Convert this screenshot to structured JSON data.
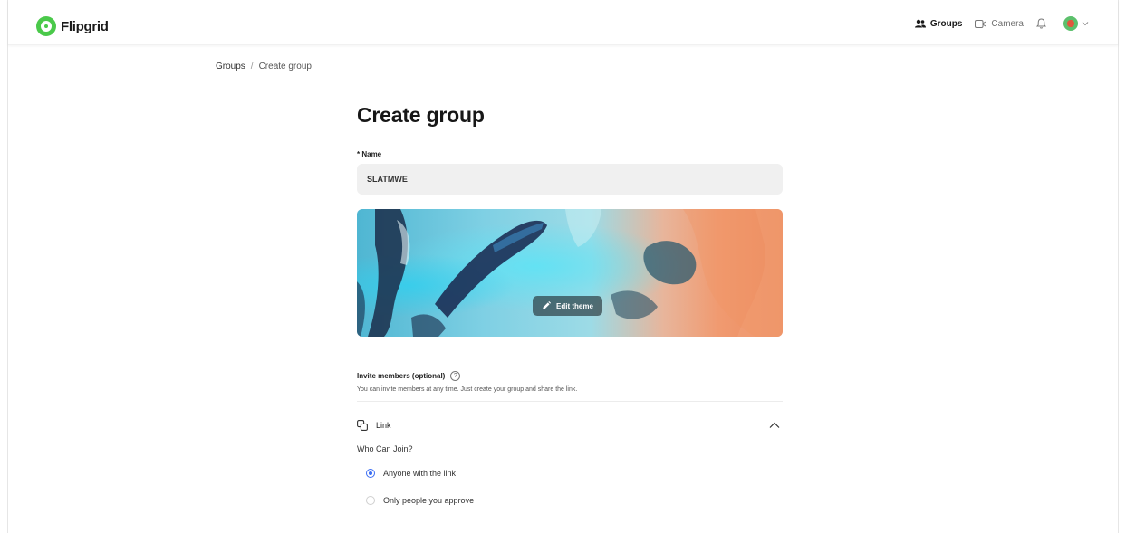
{
  "app": {
    "name": "Flipgrid"
  },
  "header": {
    "nav": [
      {
        "label": "Groups",
        "icon": "groups-icon",
        "active": true
      },
      {
        "label": "Camera",
        "icon": "camera-icon",
        "active": false
      }
    ],
    "notifications_icon": "bell-icon",
    "avatar_icon": "avatar"
  },
  "breadcrumb": {
    "parent": "Groups",
    "separator": "/",
    "current": "Create group"
  },
  "form": {
    "title": "Create group",
    "name_label": "* Name",
    "name_value": "SLATMWE",
    "edit_theme_label": "Edit theme",
    "invite_title": "Invite members (optional)",
    "invite_help": "?",
    "invite_subtitle": "You can invite members at any time. Just create your group and share the link.",
    "link_label": "Link",
    "who_can_join": "Who Can Join?",
    "join_options": [
      {
        "label": "Anyone with the link",
        "selected": true
      },
      {
        "label": "Only people you approve",
        "selected": false
      }
    ]
  },
  "colors": {
    "accent": "#3b6df3",
    "brand": "#4ac94a"
  }
}
